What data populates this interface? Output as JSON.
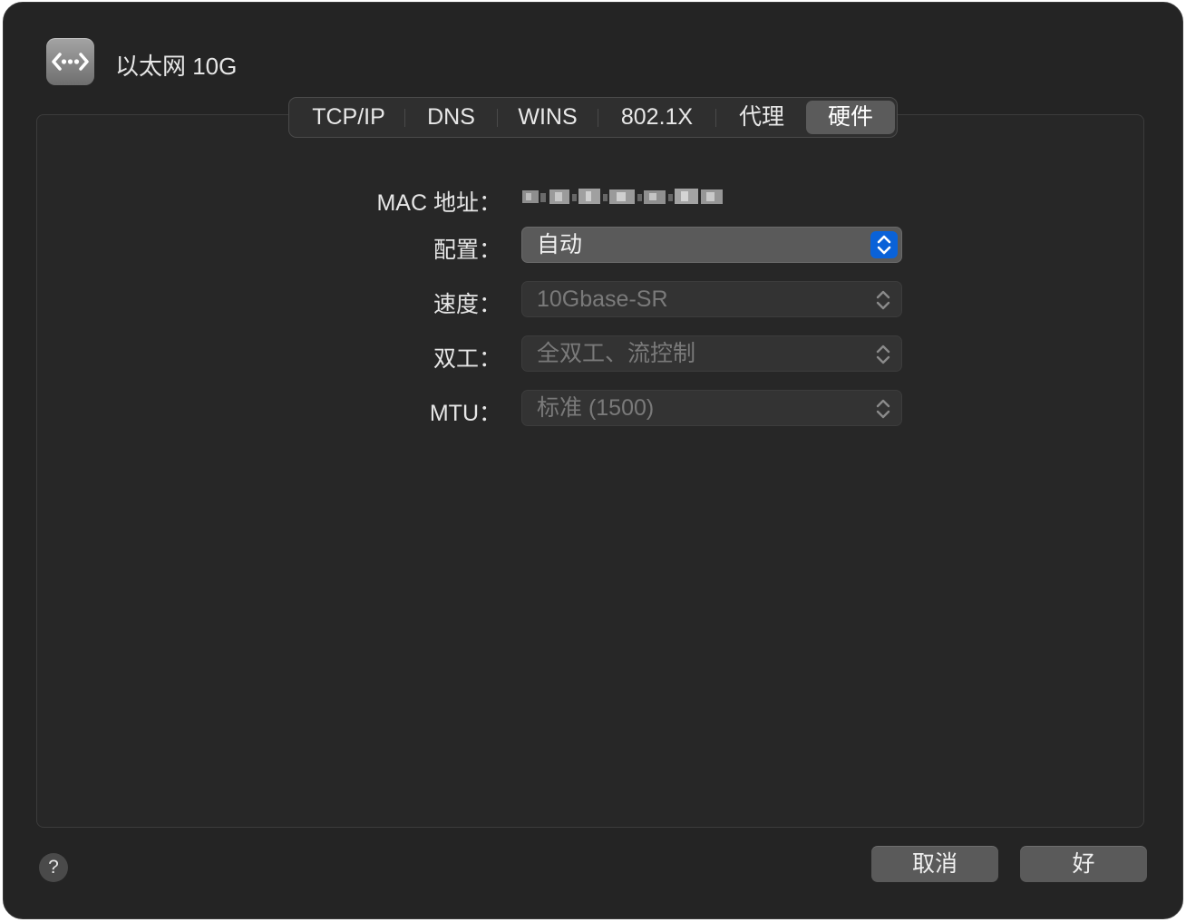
{
  "window": {
    "title": "以太网 10G",
    "icon": "ethernet-icon"
  },
  "tabs": [
    {
      "label": "TCP/IP",
      "selected": false
    },
    {
      "label": "DNS",
      "selected": false
    },
    {
      "label": "WINS",
      "selected": false
    },
    {
      "label": "802.1X",
      "selected": false
    },
    {
      "label": "代理",
      "selected": false
    },
    {
      "label": "硬件",
      "selected": true
    }
  ],
  "hardware": {
    "mac": {
      "label": "MAC 地址：",
      "value_redacted": true
    },
    "configure": {
      "label": "配置：",
      "value": "自动"
    },
    "speed": {
      "label": "速度：",
      "value": "10Gbase-SR"
    },
    "duplex": {
      "label": "双工：",
      "value": "全双工、流控制"
    },
    "mtu": {
      "label": "MTU：",
      "value": "标准 (1500)"
    }
  },
  "footer": {
    "help": "?",
    "cancel_label": "取消",
    "ok_label": "好"
  },
  "colors": {
    "accent": "#0a62d8",
    "window_bg": "#242424",
    "button_bg": "#5a5a5a"
  }
}
